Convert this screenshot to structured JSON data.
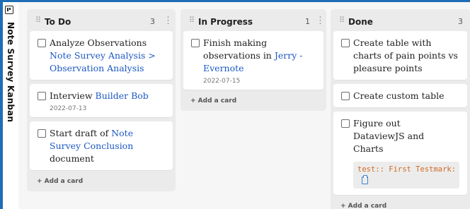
{
  "board": {
    "title": "Note Survey Kanban"
  },
  "lanes": [
    {
      "title": "To Do",
      "count": "3",
      "menu_icon": "more-vertical-icon",
      "add_card_label": "+ Add a card",
      "cards": [
        {
          "text": "Analyze Observations ",
          "link": "Note Survey Analysis > Observation Analysis",
          "checked": false
        },
        {
          "text": "Interview ",
          "link": "Builder Bob",
          "date": "2022-07-13",
          "checked": false
        },
        {
          "text": "Start draft of ",
          "link": "Note Survey Conclusion",
          "text_after": " document",
          "checked": false
        }
      ]
    },
    {
      "title": "In Progress",
      "count": "1",
      "menu_icon": "more-vertical-icon",
      "add_card_label": "+ Add a card",
      "cards": [
        {
          "text": "Finish making observations in ",
          "link": "Jerry - Evernote",
          "date": "2022-07-15",
          "checked": false
        }
      ]
    },
    {
      "title": "Done",
      "count": "3",
      "add_card_label": "+ Add a card",
      "cards": [
        {
          "text": "Create table with charts of pain points vs pleasure points",
          "checked": false
        },
        {
          "text": "Create custom table",
          "checked": false
        },
        {
          "text": "Figure out DataviewJS and Charts",
          "code": "test:: First Testmark:",
          "checked": false
        }
      ]
    }
  ],
  "colors": {
    "link": "#1c58c4",
    "code": "#d26a24",
    "frame": "#1f6eb5",
    "lane_bg": "#ebebeb",
    "board_bg": "#f6f6f6"
  }
}
